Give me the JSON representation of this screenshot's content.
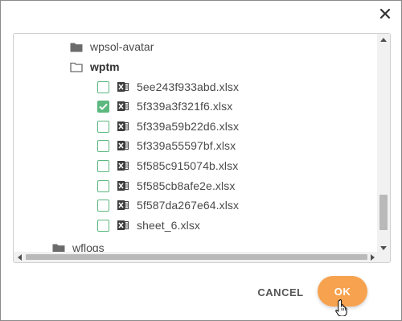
{
  "dialog": {
    "close_icon": "close-icon",
    "tree": {
      "folders": [
        {
          "label": "wpsol-avatar",
          "icon": "folder-filled-icon",
          "bold": false
        },
        {
          "label": "wptm",
          "icon": "folder-open-outline-icon",
          "bold": true
        }
      ],
      "files": [
        {
          "name": "5ee243f933abd.xlsx",
          "checked": false
        },
        {
          "name": "5f339a3f321f6.xlsx",
          "checked": true
        },
        {
          "name": "5f339a59b22d6.xlsx",
          "checked": false
        },
        {
          "name": "5f339a55597bf.xlsx",
          "checked": false
        },
        {
          "name": "5f585c915074b.xlsx",
          "checked": false
        },
        {
          "name": "5f585cb8afe2e.xlsx",
          "checked": false
        },
        {
          "name": "5f587da267e64.xlsx",
          "checked": false
        },
        {
          "name": "sheet_6.xlsx",
          "checked": false
        }
      ],
      "bottom_folder": {
        "label": "wflogs",
        "icon": "folder-filled-icon"
      }
    },
    "buttons": {
      "cancel_label": "CANCEL",
      "ok_label": "OK"
    },
    "colors": {
      "checkbox_accent": "#5cb87f",
      "ok_button": "#f7a24f"
    }
  }
}
